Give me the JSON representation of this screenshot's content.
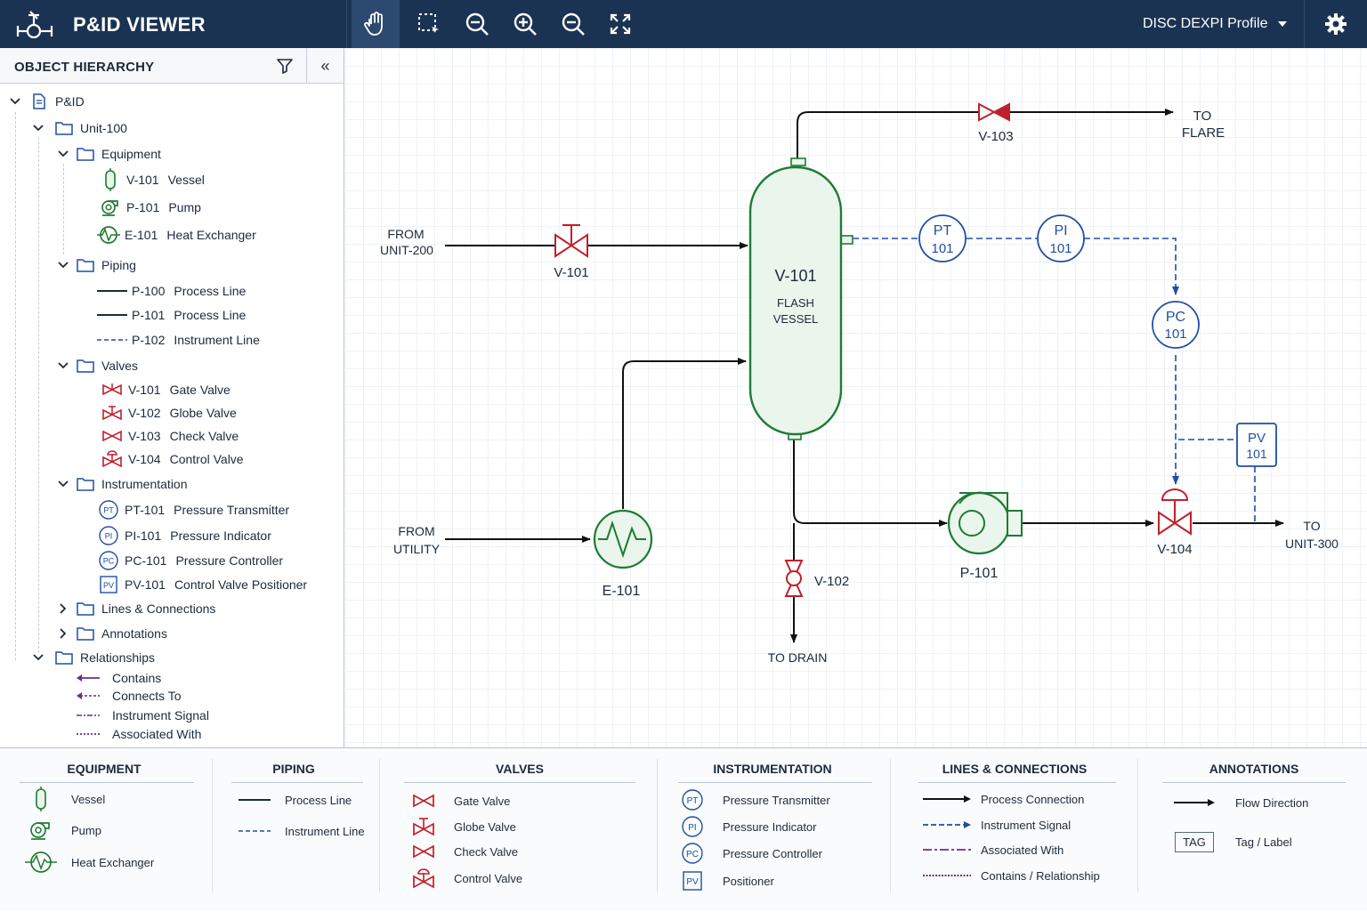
{
  "app": {
    "title": "P&ID VIEWER",
    "profile": "DISC DEXPI Profile"
  },
  "toolbar": [
    "pan-tool",
    "select-region-tool",
    "zoom-out-tool",
    "zoom-in-tool",
    "zoom-fit-tool",
    "fullscreen-tool"
  ],
  "sidebar": {
    "title": "OBJECT HIERARCHY",
    "collapse": "«",
    "root": "P&ID",
    "unit": "Unit-100",
    "equipment": {
      "label": "Equipment",
      "items": [
        {
          "tag": "V-101",
          "name": "Vessel",
          "icon": "vessel-icon"
        },
        {
          "tag": "P-101",
          "name": "Pump",
          "icon": "pump-icon"
        },
        {
          "tag": "E-101",
          "name": "Heat Exchanger",
          "icon": "heat-exchanger-icon"
        }
      ]
    },
    "piping": {
      "label": "Piping",
      "items": [
        {
          "tag": "P-100",
          "name": "Process Line"
        },
        {
          "tag": "P-101",
          "name": "Process Line"
        },
        {
          "tag": "P-102",
          "name": "Instrument Line"
        }
      ]
    },
    "valves": {
      "label": "Valves",
      "items": [
        {
          "tag": "V-101",
          "name": "Gate Valve"
        },
        {
          "tag": "V-102",
          "name": "Globe Valve"
        },
        {
          "tag": "V-103",
          "name": "Check Valve"
        },
        {
          "tag": "V-104",
          "name": "Control Valve"
        }
      ]
    },
    "instrumentation": {
      "label": "Instrumentation",
      "items": [
        {
          "abbr": "PT",
          "tag": "PT-101",
          "name": "Pressure Transmitter"
        },
        {
          "abbr": "PI",
          "tag": "PI-101",
          "name": "Pressure Indicator"
        },
        {
          "abbr": "PC",
          "tag": "PC-101",
          "name": "Pressure Controller"
        },
        {
          "abbr": "PV",
          "tag": "PV-101",
          "name": "Control Valve Positioner"
        }
      ]
    },
    "lines": "Lines & Connections",
    "annotations": "Annotations",
    "relationships": {
      "label": "Relationships",
      "items": [
        "Contains",
        "Connects To",
        "Instrument Signal",
        "Associated With"
      ]
    }
  },
  "diagram": {
    "vessel": {
      "tag": "V-101",
      "line1": "FLASH",
      "line2": "VESSEL"
    },
    "from_unit": [
      "FROM",
      "UNIT-200"
    ],
    "from_utility": [
      "FROM",
      "UTILITY"
    ],
    "to_flare": [
      "TO",
      "FLARE"
    ],
    "to_unit": [
      "TO",
      "UNIT-300"
    ],
    "to_drain": "TO DRAIN",
    "v101": "V-101",
    "v102": "V-102",
    "v103": "V-103",
    "v104": "V-104",
    "e101": "E-101",
    "p101": "P-101",
    "pt": [
      "PT",
      "101"
    ],
    "pi": [
      "PI",
      "101"
    ],
    "pc": [
      "PC",
      "101"
    ],
    "pv": [
      "PV",
      "101"
    ]
  },
  "legend": {
    "equipment": {
      "title": "EQUIPMENT",
      "items": [
        "Vessel",
        "Pump",
        "Heat Exchanger"
      ]
    },
    "piping": {
      "title": "PIPING",
      "items": [
        "Process Line",
        "Instrument Line"
      ]
    },
    "valves": {
      "title": "VALVES",
      "items": [
        "Gate Valve",
        "Globe Valve",
        "Check Valve",
        "Control Valve"
      ]
    },
    "instrumentation": {
      "title": "INSTRUMENTATION",
      "abbrs": [
        "PT",
        "PI",
        "PC",
        "PV"
      ],
      "items": [
        "Pressure Transmitter",
        "Pressure Indicator",
        "Pressure Controller",
        "Positioner"
      ]
    },
    "lines": {
      "title": "LINES & CONNECTIONS",
      "items": [
        "Process Connection",
        "Instrument Signal",
        "Associated With",
        "Contains / Relationship"
      ]
    },
    "annotations": {
      "title": "ANNOTATIONS",
      "tag_box": "TAG",
      "items": [
        "Flow Direction",
        "Tag / Label"
      ]
    }
  },
  "colors": {
    "topbar": "#1b3352",
    "equipment": "#1e7b34",
    "valve": "#c0202a",
    "instrument": "#1f4fa3",
    "relationship": "#6a2c91"
  }
}
